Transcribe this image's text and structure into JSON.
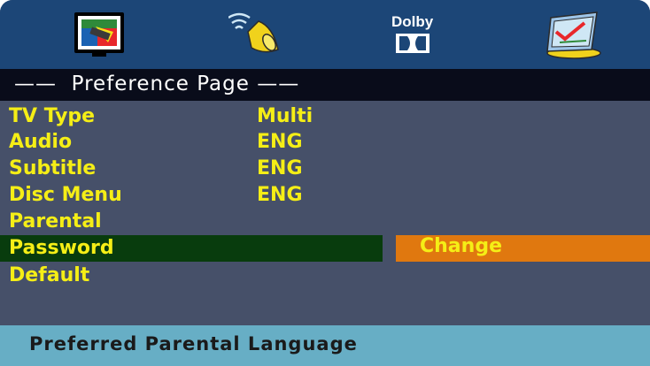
{
  "topbar": {
    "icons": [
      "tv-settings-icon",
      "audio-speaker-icon",
      "dolby-icon",
      "preference-check-icon"
    ],
    "dolby_label": "Dolby"
  },
  "page": {
    "title": "——  Preference Page ——"
  },
  "menu": {
    "items": [
      {
        "label": "TV Type",
        "value": "Multi"
      },
      {
        "label": "Audio",
        "value": "ENG"
      },
      {
        "label": "Subtitle",
        "value": "ENG"
      },
      {
        "label": "Disc Menu",
        "value": "ENG"
      },
      {
        "label": "Parental",
        "value": ""
      },
      {
        "label": "Password",
        "value": ""
      },
      {
        "label": "Default",
        "value": ""
      }
    ],
    "selected_index": 5,
    "submenu_option": "Change"
  },
  "status": {
    "text": "Preferred Parental Language"
  },
  "colors": {
    "header_bg": "#1c4677",
    "title_bg": "#090c1a",
    "menu_bg": "#465069",
    "text": "#f5ee16",
    "selected_bg": "#083c0d",
    "submenu_bg": "#e0780f",
    "status_bg": "#67aec5"
  }
}
